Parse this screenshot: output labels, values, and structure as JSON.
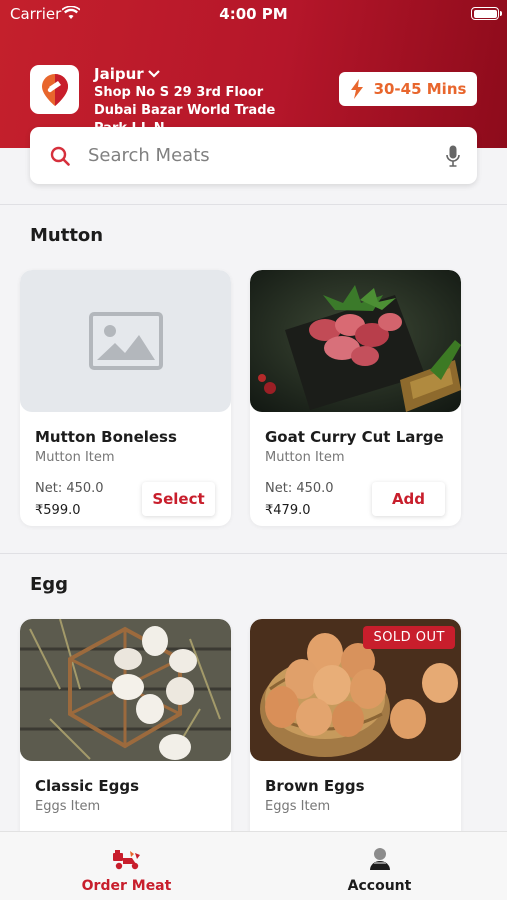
{
  "status_bar": {
    "carrier": "Carrier",
    "time": "4:00 PM"
  },
  "header": {
    "city": "Jaipur",
    "address": "Shop No S 29 3rd Floor Dubai Bazar World Trade Park J L N",
    "eta": "30-45 Mins"
  },
  "search": {
    "placeholder": "Search Meats"
  },
  "sections": [
    {
      "title": "Mutton",
      "products": [
        {
          "name": "Mutton Boneless",
          "category": "Mutton Item",
          "net": "Net: 450.0",
          "price": "₹599.0",
          "action": "Select"
        },
        {
          "name": "Goat Curry Cut Large",
          "category": "Mutton Item",
          "net": "Net: 450.0",
          "price": "₹479.0",
          "action": "Add"
        }
      ]
    },
    {
      "title": "Egg",
      "products": [
        {
          "name": "Classic Eggs",
          "category": "Eggs Item"
        },
        {
          "name": "Brown Eggs",
          "category": "Eggs Item",
          "badge": "SOLD OUT"
        }
      ]
    }
  ],
  "tabs": [
    {
      "label": "Order Meat",
      "icon": "order-meat-icon",
      "active": true,
      "color": "#c81e2c"
    },
    {
      "label": "Account",
      "icon": "account-icon",
      "active": false,
      "color": "#1c1c1c"
    }
  ],
  "colors": {
    "brand": "#c4202c",
    "accent_orange": "#e8662d"
  }
}
